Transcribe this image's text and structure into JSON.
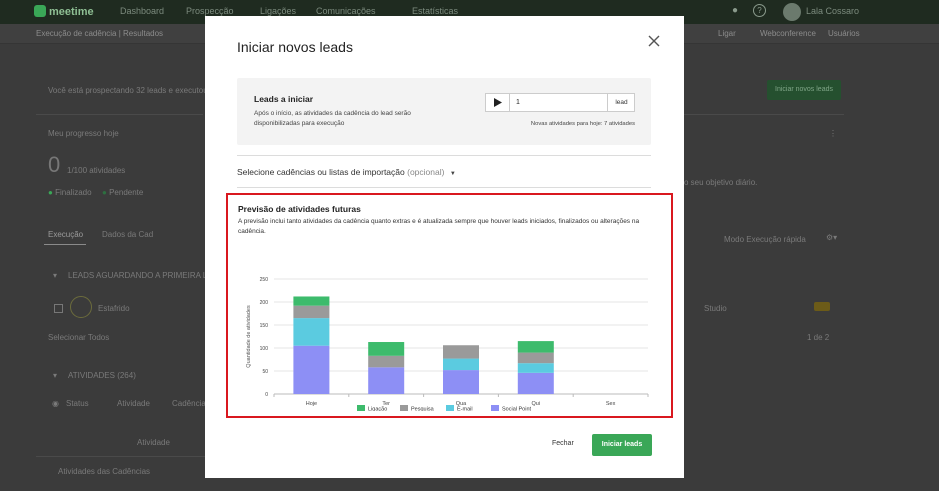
{
  "app": {
    "logo_text": "meetime",
    "nav": [
      "Dashboard",
      "Prospecção",
      "Ligações",
      "Comunicações",
      "Estatísticas"
    ],
    "user_name": "Lala Cossaro"
  },
  "subbar": {
    "breadcrumb": "Execução de cadência",
    "breadcrumb_sub": "Resultados",
    "tools": [
      "Ligar",
      "Webconference",
      "Usuários"
    ]
  },
  "background": {
    "prospecting_text": "Você está prospectando 32 leads e executou 4%",
    "start_leads_button": "Iniciar novos leads",
    "progress_title": "Meu progresso hoje",
    "progress_value": "0",
    "progress_sub": "1/100 atividades",
    "legend_a": "Finalizado",
    "legend_b": "Pendente",
    "goal_text": "o seu objetivo diário.",
    "tab_execucao": "Execução",
    "tab_dados": "Dados da Cad",
    "mode_text": "Modo Execução rápida",
    "leads_waiting": "LEADS AGUARDANDO A PRIMEIRA LIGAÇÃO",
    "row_name": "Estafrido",
    "row_tag": "Studio",
    "select_all": "Selecionar Todos",
    "pager": "1 de 2",
    "activities_title": "ATIVIDADES (264)",
    "filters": [
      "Status",
      "Atividade",
      "Cadência"
    ],
    "col_activity": "Atividade",
    "activities_footer": "Atividades das Cadências"
  },
  "modal": {
    "title": "Iniciar novos leads",
    "leads_title": "Leads a iniciar",
    "leads_desc": "Após o início, as atividades da cadência do lead serão disponibilizadas para execução",
    "lead_count": "1",
    "lead_unit": "lead",
    "new_activities": "Novas atividades para hoje: 7 atividades",
    "cadence_select_label": "Selecione cadências ou listas de importação",
    "cadence_select_optional": "(opcional)",
    "forecast_title": "Previsão de atividades futuras",
    "forecast_desc": "A previsão inclui tanto atividades da cadência quanto extras e é atualizada sempre que houver leads iniciados, finalizados ou alterações na cadência.",
    "close_label": "Fechar",
    "start_label": "Iniciar leads"
  },
  "chart_data": {
    "type": "bar",
    "stacked": true,
    "categories": [
      "Hoje",
      "Ter",
      "Qua",
      "Qui",
      "Sex"
    ],
    "ylabel": "Quantidade de atividades",
    "ylim": [
      0,
      250
    ],
    "yticks": [
      0,
      50,
      100,
      150,
      200,
      250
    ],
    "grid": true,
    "legend_position": "bottom",
    "series": [
      {
        "name": "Social Point",
        "color": "#8d8ff5",
        "values": [
          105,
          58,
          52,
          46,
          0
        ]
      },
      {
        "name": "E-mail",
        "color": "#5bcbe0",
        "values": [
          60,
          0,
          25,
          21,
          0
        ]
      },
      {
        "name": "Pesquisa",
        "color": "#9a9a9a",
        "values": [
          27,
          25,
          29,
          23,
          0
        ]
      },
      {
        "name": "Ligação",
        "color": "#3dbb6c",
        "values": [
          20,
          30,
          0,
          25,
          0
        ]
      }
    ],
    "legend_order": [
      "Ligação",
      "Pesquisa",
      "E-mail",
      "Social Point"
    ]
  }
}
